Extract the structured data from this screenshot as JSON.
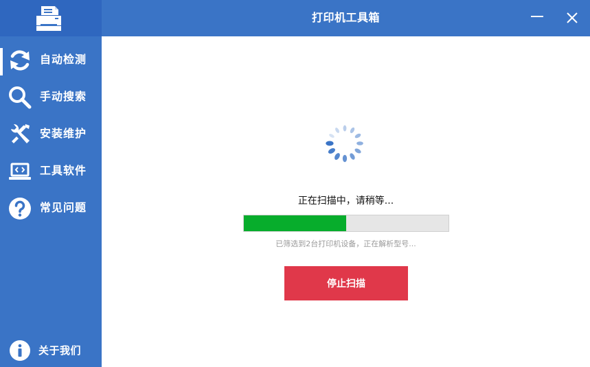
{
  "window": {
    "title": "打印机工具箱",
    "minimize_icon": "minimize-icon",
    "close_icon": "close-icon",
    "logo_icon": "printer-icon"
  },
  "sidebar": {
    "items": [
      {
        "label": "自动检测",
        "icon": "refresh-icon",
        "active": true
      },
      {
        "label": "手动搜索",
        "icon": "search-icon",
        "active": false
      },
      {
        "label": "安装维护",
        "icon": "tools-icon",
        "active": false
      },
      {
        "label": "工具软件",
        "icon": "laptop-code-icon",
        "active": false
      },
      {
        "label": "常见问题",
        "icon": "question-icon",
        "active": false
      }
    ],
    "about": {
      "label": "关于我们",
      "icon": "info-icon"
    }
  },
  "main": {
    "status_text": "正在扫描中，请稍等...",
    "progress_percent": 50,
    "sub_status": "已筛选到2台打印机设备，正在解析型号...",
    "stop_button": "停止扫描"
  },
  "colors": {
    "primary": "#3a74c6",
    "progress_fill": "#07ad2c",
    "stop_button": "#e0384a"
  }
}
